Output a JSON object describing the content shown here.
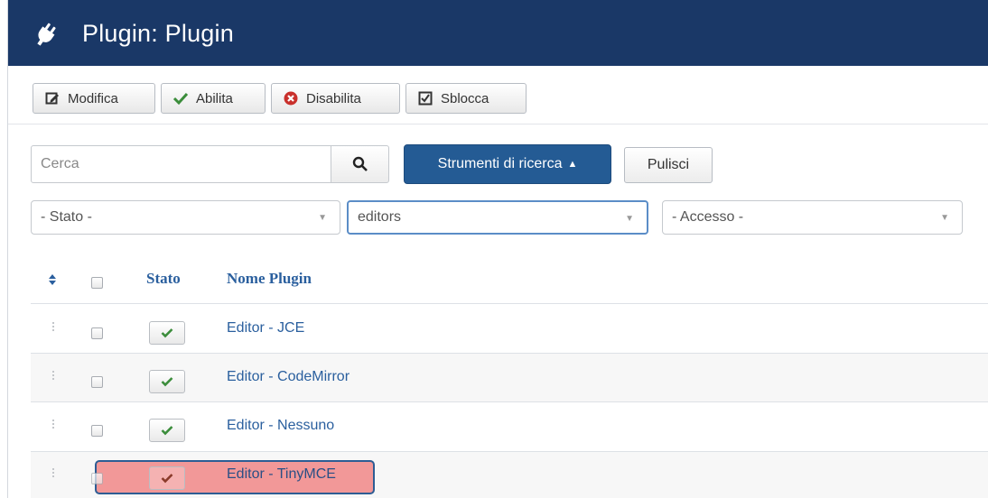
{
  "header": {
    "title": "Plugin: Plugin",
    "icon": "plug-icon",
    "color": "#1a3867"
  },
  "toolbar": {
    "edit_label": "Modifica",
    "enable_label": "Abilita",
    "disable_label": "Disabilita",
    "unlock_label": "Sblocca"
  },
  "search": {
    "placeholder": "Cerca",
    "tools_label": "Strumenti di ricerca",
    "clear_label": "Pulisci"
  },
  "filters": {
    "state": "- Stato -",
    "folder": "editors",
    "access": "- Accesso -"
  },
  "table": {
    "col_status": "Stato",
    "col_name": "Nome Plugin",
    "rows": [
      {
        "name": "Editor - JCE",
        "enabled": true
      },
      {
        "name": "Editor - CodeMirror",
        "enabled": true
      },
      {
        "name": "Editor - Nessuno",
        "enabled": true
      },
      {
        "name": "Editor - TinyMCE",
        "enabled": true,
        "highlighted": true
      }
    ]
  },
  "colors": {
    "accent": "#245b94",
    "link": "#2a5f9e",
    "highlight": "#f07878"
  }
}
